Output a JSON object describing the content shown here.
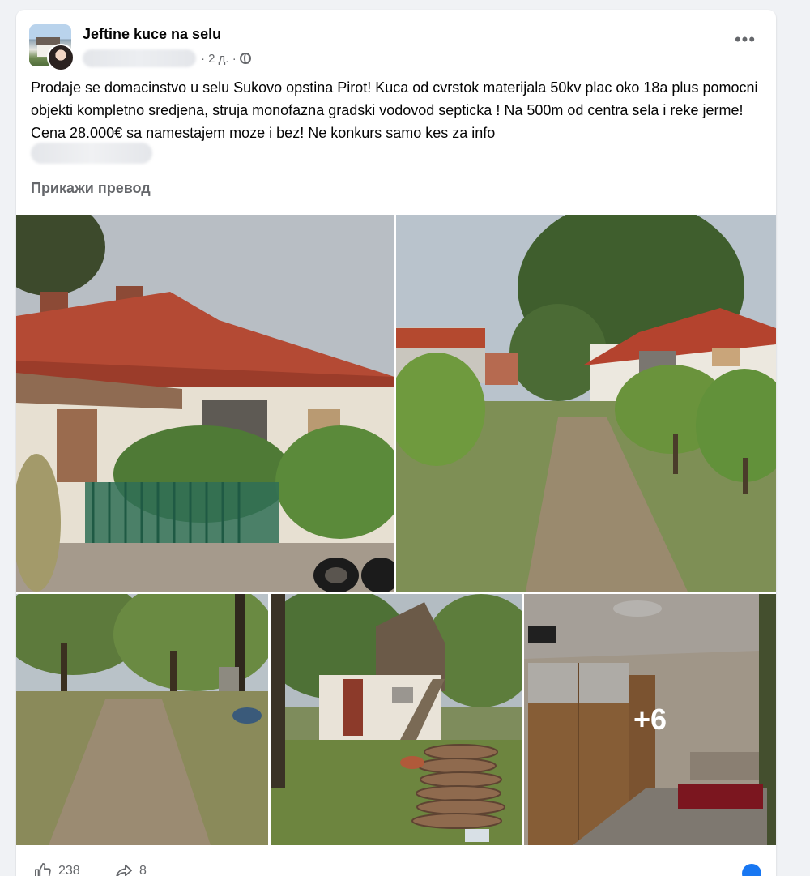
{
  "post": {
    "group_name": "Jeftine kuce na selu",
    "time_ago": "2 д.",
    "separator": "·",
    "more_label": "•••",
    "text": "Prodaje se domacinstvo u selu Sukovo opstina Pirot! Kuca od cvrstok materijala 50kv plac oko 18a plus pomocni objekti kompletno sredjena, struja monofazna gradski vodovod septicka ! Na 500m od centra sela i reke jerme! Cena 28.000€ sa namestajem moze i bez!  Ne konkurs samo kes za info",
    "translate_label": "Прикажи превод",
    "more_photos_label": "+6",
    "like_count": "238",
    "share_count": "8"
  },
  "icons": {
    "globe": "globe-icon",
    "like": "thumbs-up-icon",
    "share": "share-icon",
    "more": "more-options-icon"
  },
  "colors": {
    "accent": "#1877f2",
    "secondary_text": "#65676b"
  }
}
